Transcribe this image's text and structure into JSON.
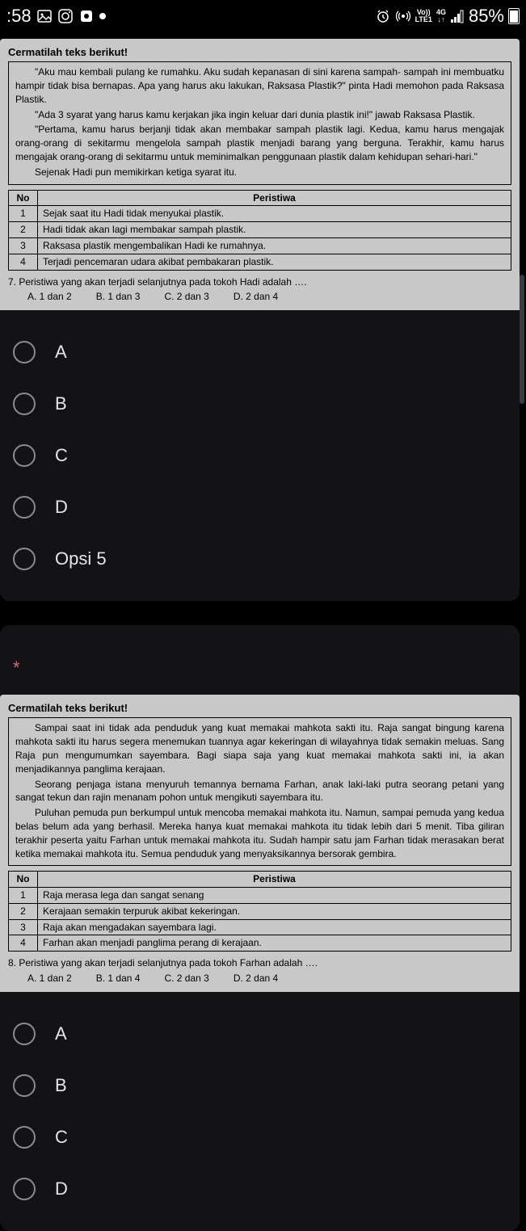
{
  "status": {
    "time": ":58",
    "battery": "85%",
    "lte_top": "Vo))",
    "lte_bot": "LTE1",
    "net_top": "4G",
    "net_bot": "↓↑"
  },
  "q7": {
    "heading": "Cermatilah teks berikut!",
    "p1": "\"Aku mau kembali pulang ke rumahku. Aku sudah kepanasan di sini karena sampah- sampah ini membuatku hampir tidak bisa bernapas. Apa yang harus aku lakukan, Raksasa Plastik?\" pinta Hadi memohon pada Raksasa Plastik.",
    "p2": "\"Ada 3 syarat yang harus kamu kerjakan jika ingin keluar dari dunia plastik ini!\" jawab Raksasa Plastik.",
    "p3": "\"Pertama, kamu harus berjanji tidak akan membakar sampah plastik lagi. Kedua, kamu harus mengajak orang-orang di sekitarmu mengelola sampah plastik menjadi barang yang berguna. Terakhir, kamu harus mengajak orang-orang di sekitarmu untuk meminimalkan penggunaan plastik dalam kehidupan sehari-hari.\"",
    "p4": "Sejenak Hadi pun memikirkan ketiga syarat itu.",
    "table": {
      "h_no": "No",
      "h_p": "Peristiwa",
      "rows": [
        {
          "no": "1",
          "p": "Sejak saat itu Hadi tidak menyukai plastik."
        },
        {
          "no": "2",
          "p": "Hadi tidak akan lagi membakar sampah plastik."
        },
        {
          "no": "3",
          "p": "Raksasa plastik mengembalikan Hadi ke rumahnya."
        },
        {
          "no": "4",
          "p": "Terjadi pencemaran udara akibat pembakaran plastik."
        }
      ]
    },
    "question": "7.   Peristiwa yang akan terjadi selanjutnya pada tokoh Hadi  adalah ….",
    "optsA": "A.   1 dan 2",
    "optsB": "B. 1 dan 3",
    "optsC": "C. 2 dan 3",
    "optsD": "D. 2 dan 4"
  },
  "answers": {
    "a": "A",
    "b": "B",
    "c": "C",
    "d": "D",
    "opt5": "Opsi 5"
  },
  "asterisk": "*",
  "q8": {
    "heading": "Cermatilah teks berikut!",
    "p1": "Sampai saat ini tidak ada penduduk yang kuat memakai mahkota sakti itu. Raja sangat bingung karena mahkota sakti itu harus segera menemukan tuannya agar kekeringan di wilayahnya tidak semakin meluas. Sang Raja pun mengumumkan sayembara. Bagi siapa saja yang kuat memakai mahkota sakti ini, ia akan menjadikannya panglima kerajaan.",
    "p2": "Seorang penjaga istana menyuruh temannya bernama Farhan, anak laki-laki putra seorang petani yang sangat tekun dan rajin menanam pohon untuk mengikuti sayembara itu.",
    "p3": "Puluhan pemuda pun berkumpul untuk mencoba memakai mahkota itu. Namun, sampai pemuda yang kedua belas belum ada yang berhasil.  Mereka hanya kuat memakai mahkota itu tidak lebih dari 5 menit. Tiba giliran terakhir peserta yaitu Farhan untuk memakai mahkota itu. Sudah hampir satu jam Farhan tidak merasakan berat ketika memakai mahkota itu. Semua penduduk yang menyaksikannya bersorak gembira.",
    "table": {
      "h_no": "No",
      "h_p": "Peristiwa",
      "rows": [
        {
          "no": "1",
          "p": "Raja merasa lega dan sangat senang"
        },
        {
          "no": "2",
          "p": "Kerajaan semakin terpuruk akibat kekeringan."
        },
        {
          "no": "3",
          "p": "Raja akan mengadakan sayembara lagi."
        },
        {
          "no": "4",
          "p": "Farhan akan menjadi panglima perang di kerajaan."
        }
      ]
    },
    "question": "8.   Peristiwa yang akan terjadi selanjutnya pada tokoh Farhan  adalah ….",
    "optsA": "A.   1 dan 2",
    "optsB": "B. 1 dan 4",
    "optsC": "C. 2 dan 3",
    "optsD": "D. 2 dan 4"
  }
}
